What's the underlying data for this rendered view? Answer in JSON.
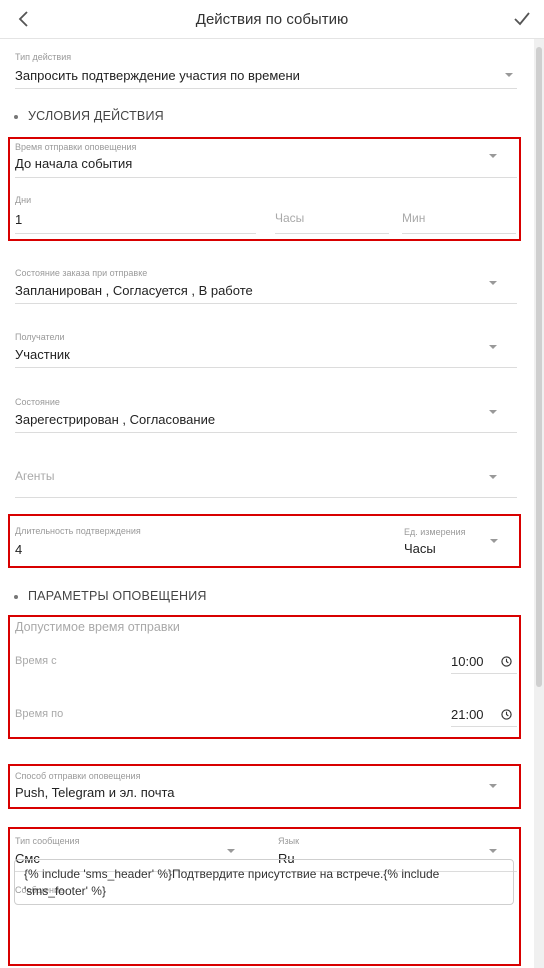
{
  "header": {
    "title": "Действия по событию",
    "back_icon": "arrow-left-icon",
    "save_icon": "check-icon"
  },
  "action_type": {
    "label": "Тип действия",
    "value": "Запросить подтверждение участия по времени"
  },
  "sections": {
    "conditions": "УСЛОВИЯ ДЕЙСТВИЯ",
    "notification_params": "ПАРАМЕТРЫ ОПОВЕЩЕНИЯ"
  },
  "send_time": {
    "label": "Время отправки оповещения",
    "value": "До начала события"
  },
  "offset": {
    "days_label": "Дни",
    "days_value": "1",
    "hours_placeholder": "Часы",
    "minutes_placeholder": "Мин"
  },
  "order_state": {
    "label": "Состояние заказа при отправке",
    "value": "Запланирован , Согласуется , В работе"
  },
  "recipients": {
    "label": "Получатели",
    "value": "Участник"
  },
  "state": {
    "label": "Состояние",
    "value": "Зарегестрирован , Согласование"
  },
  "agents": {
    "placeholder": "Агенты"
  },
  "confirm_duration": {
    "label": "Длительность подтверждения",
    "value": "4",
    "unit_label": "Ед. измерения",
    "unit_value": "Часы"
  },
  "allowed_time": {
    "title": "Допустимое время отправки",
    "from_label": "Время с",
    "from_value": "10:00",
    "to_label": "Время по",
    "to_value": "21:00"
  },
  "send_method": {
    "label": "Способ отправки оповещения",
    "value": "Push, Telegram и эл. почта"
  },
  "message_type": {
    "label": "Тип сообщения",
    "value": "Смс"
  },
  "language": {
    "label": "Язык",
    "value": "Ru"
  },
  "message": {
    "label": "Сообщение",
    "value": "{% include 'sms_header' %}Подтвердите присутствие на встрече.{% include 'sms_footer' %}"
  },
  "colors": {
    "highlight": "#d80000",
    "text": "#222222",
    "muted": "#9a9a9a"
  }
}
